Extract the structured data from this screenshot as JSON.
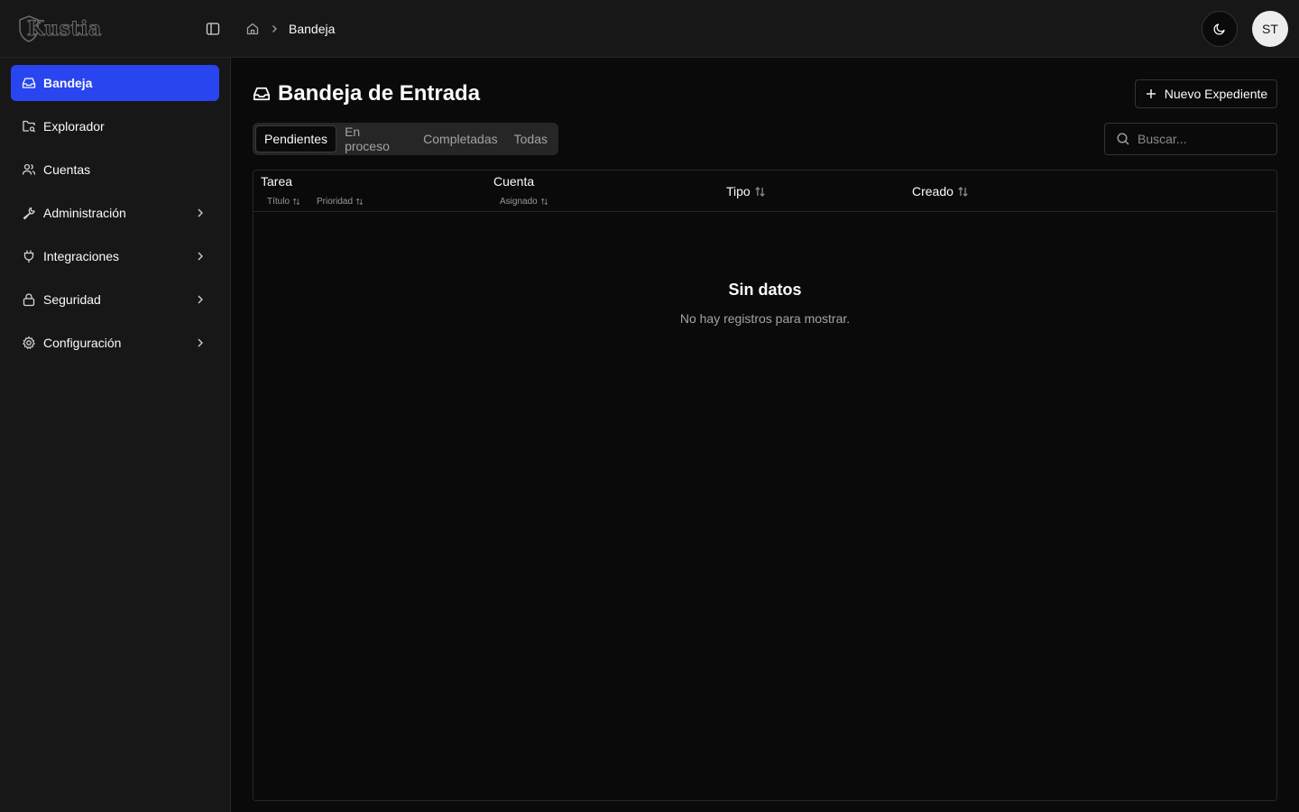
{
  "app": {
    "logo_text": "Kustia"
  },
  "breadcrumb": {
    "current": "Bandeja"
  },
  "user": {
    "initials": "ST"
  },
  "sidebar": {
    "items": [
      {
        "label": "Bandeja",
        "icon": "inbox-icon",
        "active": true
      },
      {
        "label": "Explorador",
        "icon": "folder-search-icon"
      },
      {
        "label": "Cuentas",
        "icon": "users-icon"
      },
      {
        "label": "Administración",
        "icon": "wrench-icon",
        "expandable": true
      },
      {
        "label": "Integraciones",
        "icon": "plug-icon",
        "expandable": true
      },
      {
        "label": "Seguridad",
        "icon": "lock-icon",
        "expandable": true
      },
      {
        "label": "Configuración",
        "icon": "gear-icon",
        "expandable": true
      }
    ]
  },
  "main": {
    "title": "Bandeja de Entrada",
    "new_button": "Nuevo Expediente",
    "tabs": [
      {
        "label": "Pendientes",
        "active": true
      },
      {
        "label": "En proceso"
      },
      {
        "label": "Completadas"
      },
      {
        "label": "Todas"
      }
    ],
    "search": {
      "placeholder": "Buscar..."
    },
    "table": {
      "columns": {
        "tarea": "Tarea",
        "titulo": "Título",
        "prioridad": "Prioridad",
        "cuenta": "Cuenta",
        "asignado": "Asignado",
        "tipo": "Tipo",
        "creado": "Creado"
      },
      "rows": [],
      "empty_title": "Sin datos",
      "empty_description": "No hay registros para mostrar."
    }
  },
  "colors": {
    "background": "#0a0a0a",
    "surface": "#171717",
    "accent": "#2845f0",
    "border": "#262626"
  }
}
